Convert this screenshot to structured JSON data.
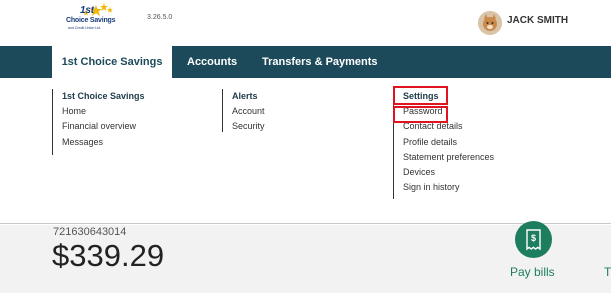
{
  "header": {
    "logo": {
      "line1": "1st",
      "line2": "Choice Savings",
      "line3": "and Credit Union Ltd."
    },
    "version": "3.26.5.0",
    "user_name": "JACK SMITH"
  },
  "nav": {
    "tabs": [
      {
        "label": "1st Choice Savings",
        "active": true
      },
      {
        "label": "Accounts",
        "active": false
      },
      {
        "label": "Transfers & Payments",
        "active": false
      }
    ]
  },
  "menu": {
    "columns": [
      {
        "heading": "1st Choice Savings",
        "items": [
          "Home",
          "Financial overview",
          "Messages"
        ]
      },
      {
        "heading": "Alerts",
        "items": [
          "Account",
          "Security"
        ]
      },
      {
        "heading": "Settings",
        "items": [
          "Password",
          "Contact details",
          "Profile details",
          "Statement preferences",
          "Devices",
          "Sign in history"
        ]
      }
    ]
  },
  "account": {
    "number": "721630643014",
    "balance": "$339.29"
  },
  "quick_actions": {
    "pay_bills": "Pay bills",
    "next_cut": "T"
  },
  "colors": {
    "nav_bg": "#1d4a5a",
    "highlight": "#e0141e",
    "action_green": "#1d7d5f"
  }
}
